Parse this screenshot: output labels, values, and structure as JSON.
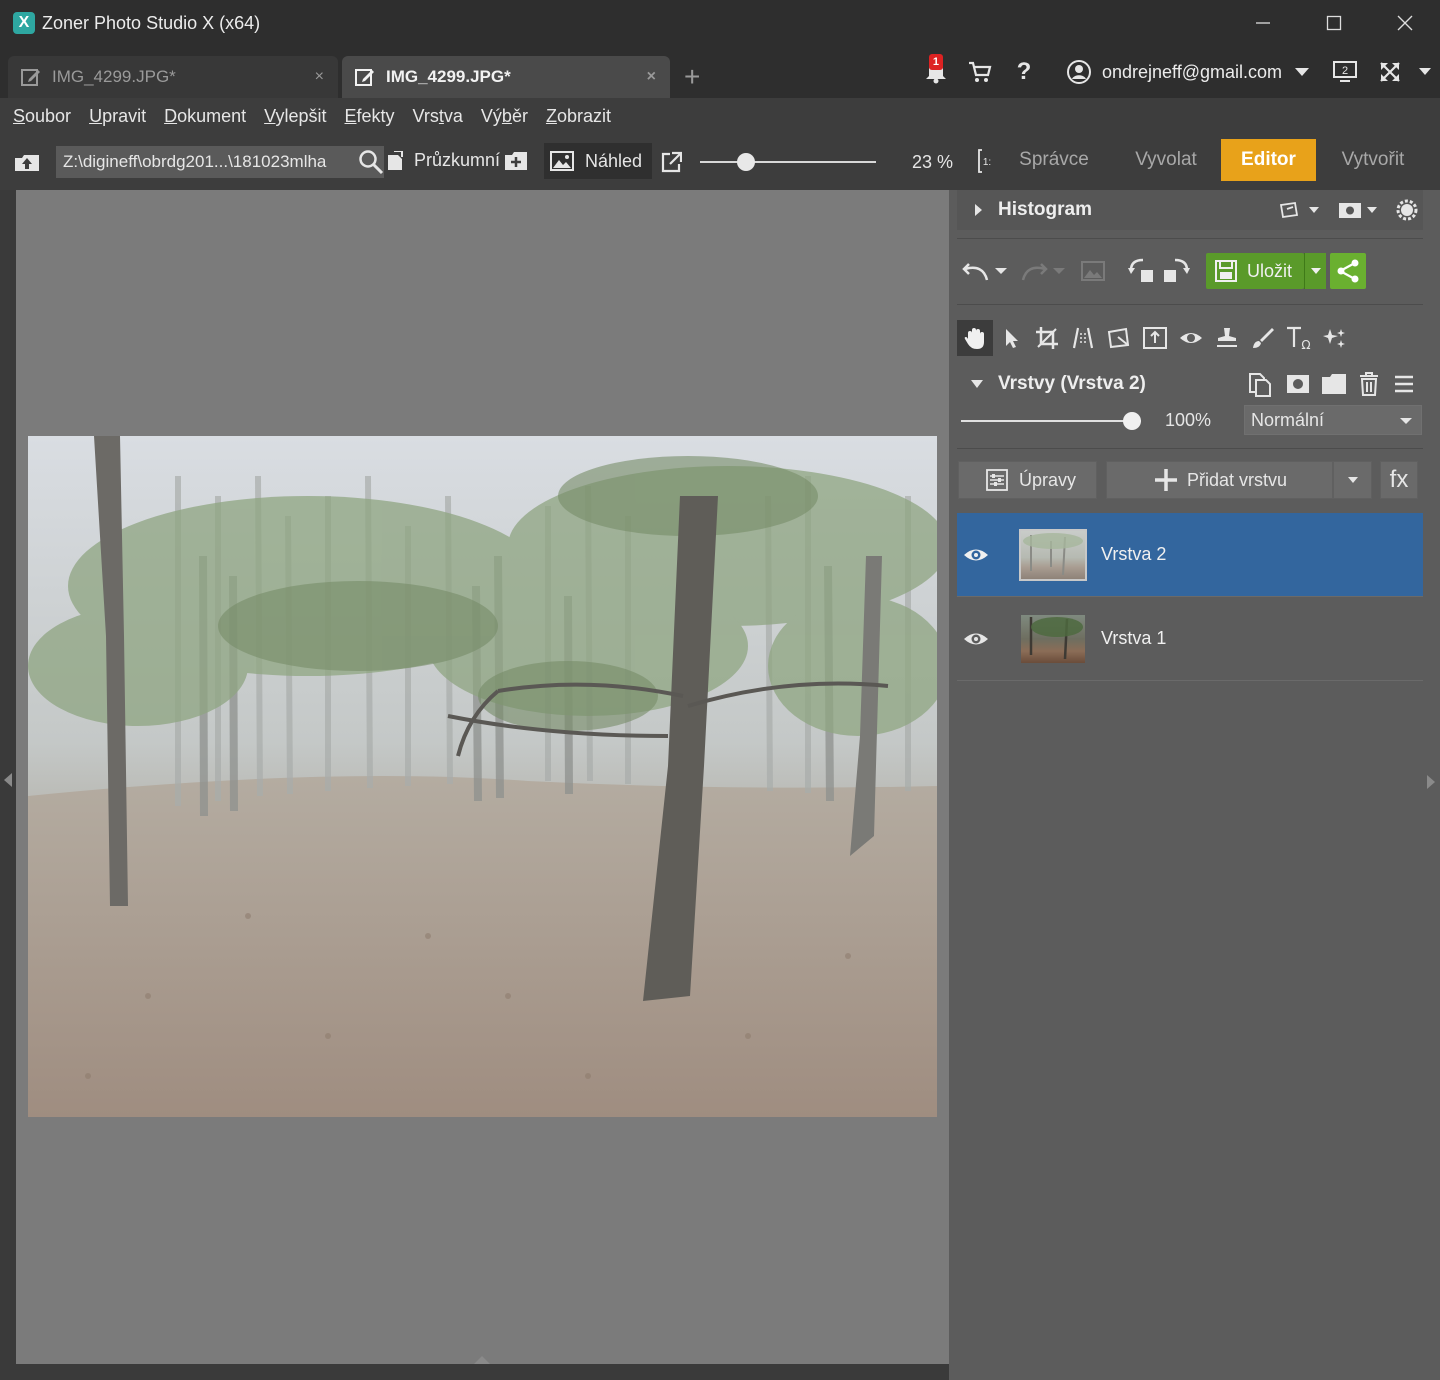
{
  "window": {
    "title": "Zoner Photo Studio X (x64)",
    "logo_letter": "X"
  },
  "tabs": [
    {
      "label": "IMG_4299.JPG*",
      "active": false,
      "close": "×"
    },
    {
      "label": "IMG_4299.JPG*",
      "active": true,
      "close": "×"
    }
  ],
  "tab_add": "+",
  "header": {
    "notifications_count": "1",
    "help": "?",
    "user_email": "ondrejneff@gmail.com",
    "monitor_number": "2"
  },
  "menu": [
    {
      "underline": "S",
      "rest": "oubor"
    },
    {
      "underline": "U",
      "rest": "pravit"
    },
    {
      "underline": "D",
      "rest": "okument"
    },
    {
      "underline": "V",
      "rest": "ylepšit"
    },
    {
      "underline": "E",
      "rest": "fekty"
    },
    {
      "label_a": "Vrs",
      "underline": "t",
      "rest": "va"
    },
    {
      "label_a": "Vý",
      "underline": "b",
      "rest": "ěr"
    },
    {
      "underline": "Z",
      "rest": "obrazit"
    }
  ],
  "toolbar": {
    "path": "Z:\\digineff\\obrdg201...\\181023mlha",
    "explorer_label": "Průzkumní",
    "preview_label": "Náhled",
    "zoom_percent": "23 %",
    "zoom_level_fraction": 0.23,
    "one_to_one": "1:",
    "modules": [
      "Správce",
      "Vyvolat",
      "Editor",
      "Vytvořit"
    ],
    "active_module": "Editor"
  },
  "panel": {
    "histogram_title": "Histogram",
    "save_label": "Uložit",
    "layers_title": "Vrstvy (Vrstva 2)",
    "opacity": "100%",
    "opacity_fraction": 1.0,
    "blend_mode": "Normální",
    "adjustments_label": "Úpravy",
    "add_layer_label": "Přidat vrstvu",
    "fx_label": "fx",
    "layers": [
      {
        "name": "Vrstva 2",
        "selected": true
      },
      {
        "name": "Vrstva 1",
        "selected": false
      }
    ]
  },
  "colors": {
    "accent_editor": "#e8a21a",
    "save_green": "#5a9a2a",
    "selection_blue": "#33669e"
  }
}
